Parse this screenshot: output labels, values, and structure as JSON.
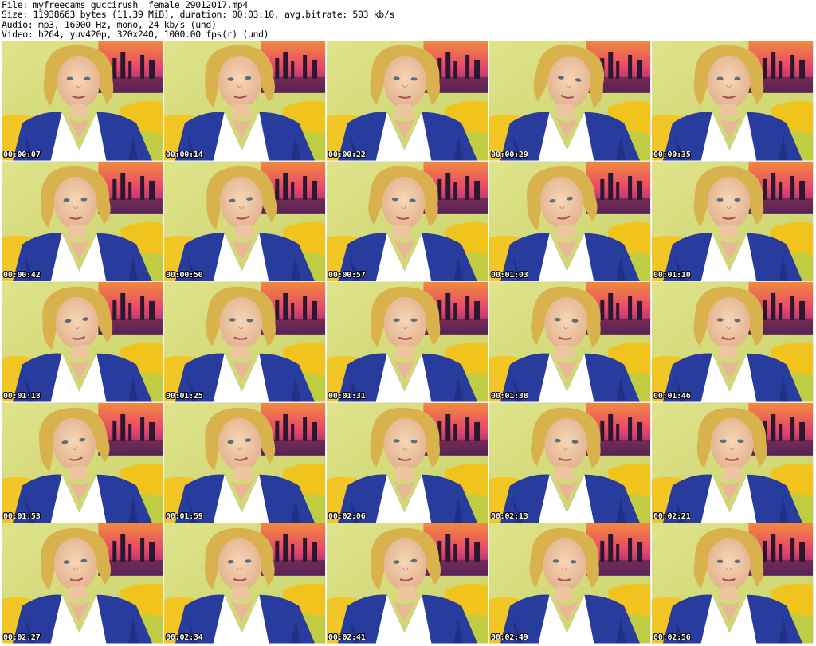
{
  "info": {
    "file": "File: myfreecams_guccirush__female_29012017.mp4",
    "size": "Size: 11938663 bytes (11.39 MiB), duration: 00:03:10, avg.bitrate: 503 kb/s",
    "audio": "Audio: mp3, 16000 Hz, mono, 24 kb/s (und)",
    "video": "Video: h264, yuv420p, 320x240, 1000.00 fps(r) (und)"
  },
  "frames": [
    {
      "timestamp": "00:00:07"
    },
    {
      "timestamp": "00:00:14"
    },
    {
      "timestamp": "00:00:22"
    },
    {
      "timestamp": "00:00:29"
    },
    {
      "timestamp": "00:00:35"
    },
    {
      "timestamp": "00:00:42"
    },
    {
      "timestamp": "00:00:50"
    },
    {
      "timestamp": "00:00:57"
    },
    {
      "timestamp": "00:01:03"
    },
    {
      "timestamp": "00:01:10"
    },
    {
      "timestamp": "00:01:18"
    },
    {
      "timestamp": "00:01:25"
    },
    {
      "timestamp": "00:01:31"
    },
    {
      "timestamp": "00:01:38"
    },
    {
      "timestamp": "00:01:46"
    },
    {
      "timestamp": "00:01:53"
    },
    {
      "timestamp": "00:01:59"
    },
    {
      "timestamp": "00:02:06"
    },
    {
      "timestamp": "00:02:13"
    },
    {
      "timestamp": "00:02:21"
    },
    {
      "timestamp": "00:02:27"
    },
    {
      "timestamp": "00:02:34"
    },
    {
      "timestamp": "00:02:41"
    },
    {
      "timestamp": "00:02:49"
    },
    {
      "timestamp": "00:02:56"
    }
  ]
}
